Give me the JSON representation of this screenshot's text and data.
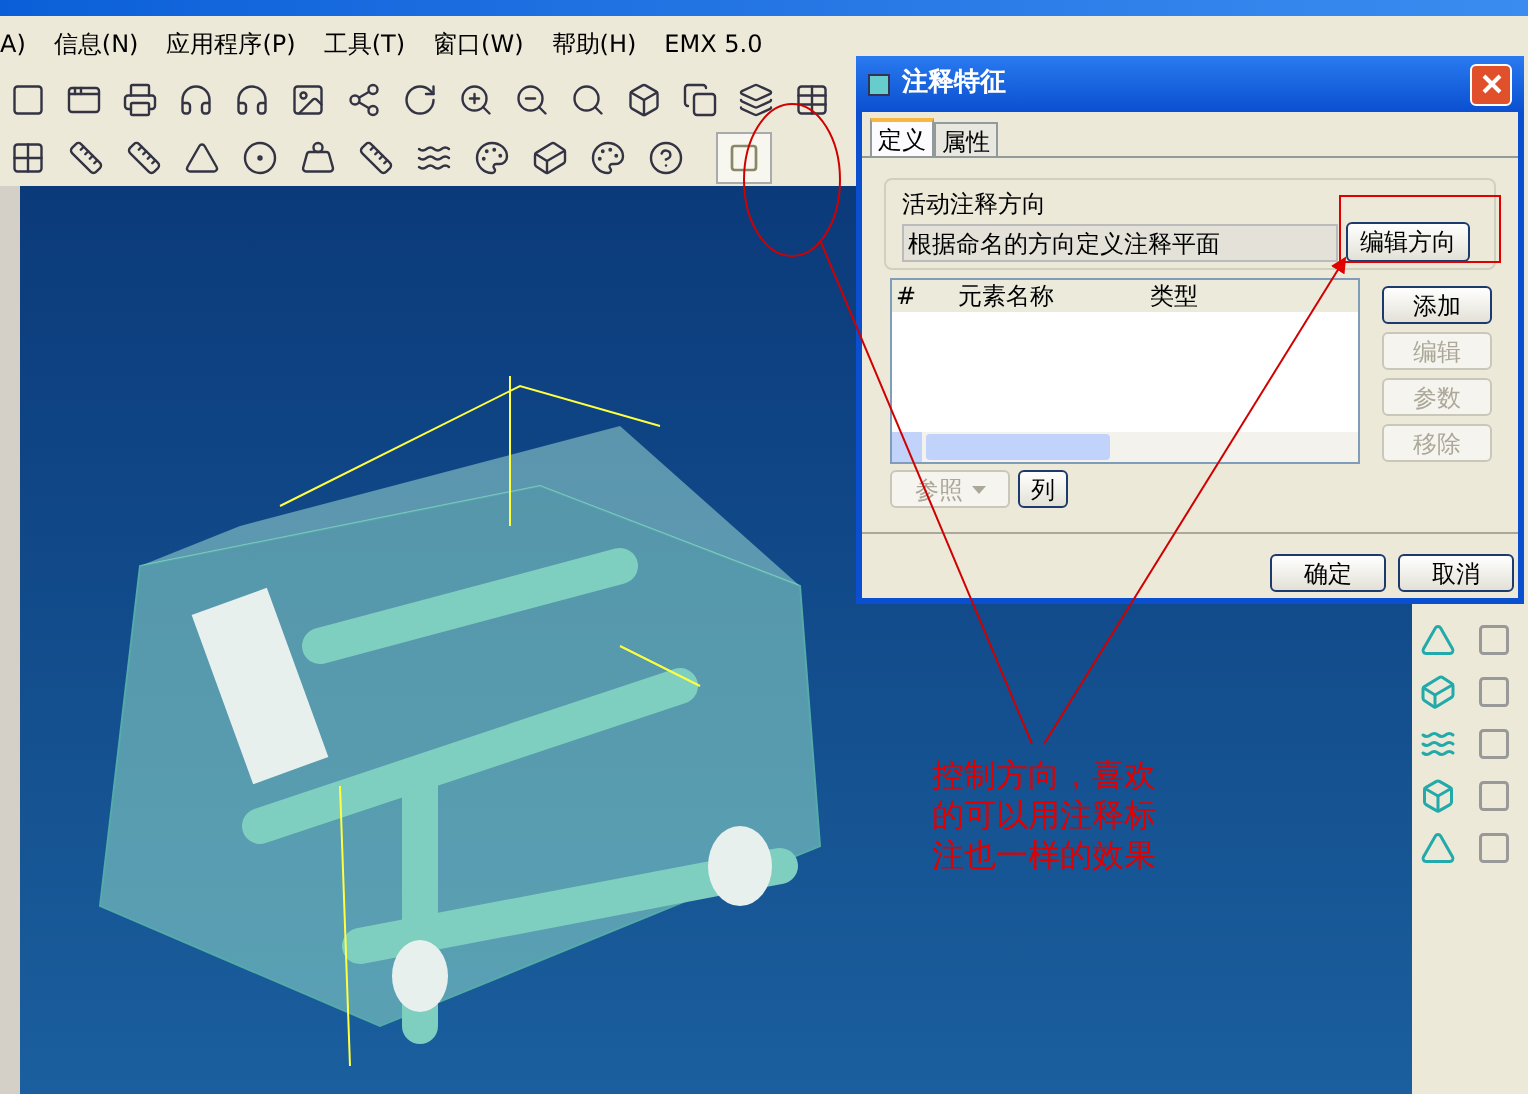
{
  "menu_bar": {
    "items": [
      "A)",
      "信息(N)",
      "应用程序(P)",
      "工具(T)",
      "窗口(W)",
      "帮助(H)",
      "EMX 5.0"
    ]
  },
  "dialog": {
    "title": "注释特征",
    "tabs": [
      {
        "label": "定义",
        "selected": true
      },
      {
        "label": "属性",
        "selected": false
      }
    ],
    "direction_group": {
      "label": "活动注释方向",
      "value": "根据命名的方向定义注释平面",
      "button": "编辑方向"
    },
    "table": {
      "columns": [
        "#",
        "元素名称",
        "类型"
      ]
    },
    "side_buttons": [
      {
        "label": "添加",
        "disabled": false
      },
      {
        "label": "编辑",
        "disabled": true
      },
      {
        "label": "参数",
        "disabled": true
      },
      {
        "label": "移除",
        "disabled": true
      }
    ],
    "reference_button": {
      "label": "参照",
      "disabled": true
    },
    "column_button": {
      "label": "列",
      "disabled": false
    },
    "footer_buttons": [
      "确定",
      "取消"
    ]
  },
  "annotation": {
    "text": "控制方向，喜欢的可以用注释标注也一样的效果"
  }
}
